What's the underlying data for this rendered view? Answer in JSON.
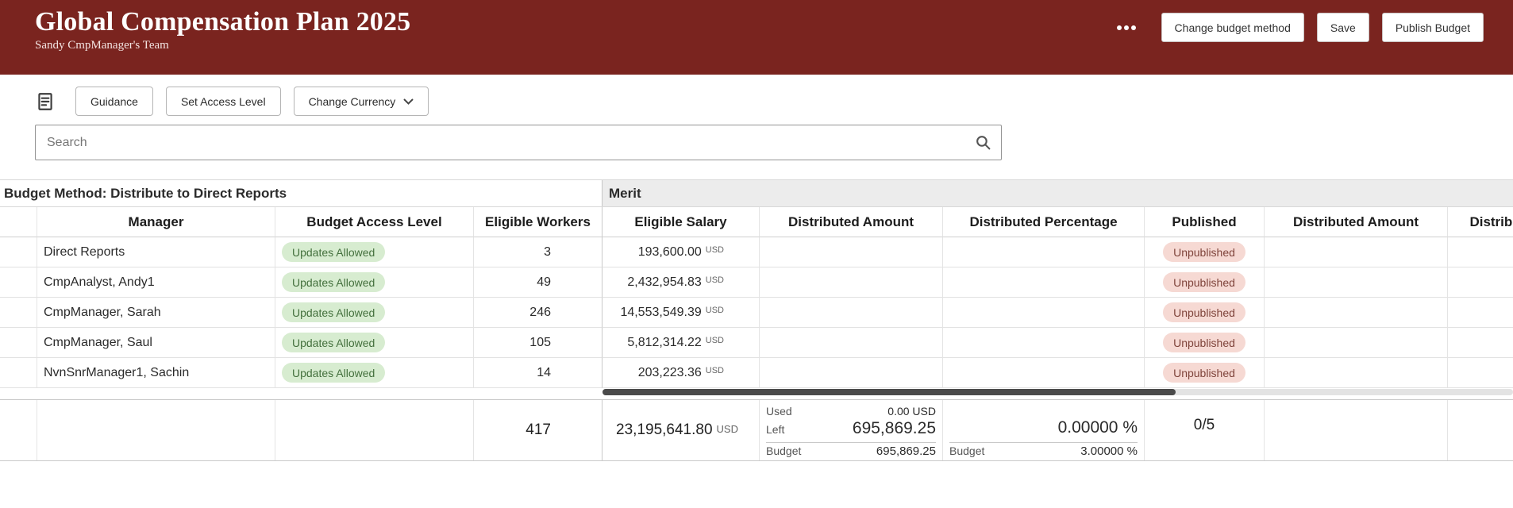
{
  "header": {
    "title": "Global Compensation Plan 2025",
    "subtitle": "Sandy CmpManager's Team",
    "buttons": {
      "change_budget_method": "Change budget method",
      "save": "Save",
      "publish_budget": "Publish Budget"
    }
  },
  "toolbar": {
    "guidance": "Guidance",
    "set_access_level": "Set Access Level",
    "change_currency": "Change Currency"
  },
  "search": {
    "placeholder": "Search"
  },
  "grid": {
    "group_left": "Budget Method: Distribute to Direct Reports",
    "group_right": "Merit",
    "columns": [
      "Manager",
      "Budget Access Level",
      "Eligible Workers",
      "Eligible Salary",
      "Distributed Amount",
      "Distributed Percentage",
      "Published",
      "Distributed Amount",
      "Distributed Percentage"
    ],
    "rows": [
      {
        "manager": "Direct Reports",
        "access": "Updates Allowed",
        "workers": "3",
        "salary": "193,600.00",
        "currency": "USD",
        "published": "Unpublished"
      },
      {
        "manager": "CmpAnalyst, Andy1",
        "access": "Updates Allowed",
        "workers": "49",
        "salary": "2,432,954.83",
        "currency": "USD",
        "published": "Unpublished"
      },
      {
        "manager": "CmpManager, Sarah",
        "access": "Updates Allowed",
        "workers": "246",
        "salary": "14,553,549.39",
        "currency": "USD",
        "published": "Unpublished"
      },
      {
        "manager": "CmpManager, Saul",
        "access": "Updates Allowed",
        "workers": "105",
        "salary": "5,812,314.22",
        "currency": "USD",
        "published": "Unpublished"
      },
      {
        "manager": "NvnSnrManager1, Sachin",
        "access": "Updates Allowed",
        "workers": "14",
        "salary": "203,223.36",
        "currency": "USD",
        "published": "Unpublished"
      }
    ],
    "summary": {
      "workers_total": "417",
      "salary_total": "23,195,641.80",
      "salary_currency": "USD",
      "amount": {
        "used_label": "Used",
        "used_value": "0.00 USD",
        "left_label": "Left",
        "left_value": "695,869.25",
        "budget_label": "Budget",
        "budget_value": "695,869.25"
      },
      "percentage": {
        "value": "0.00000 %",
        "budget_label": "Budget",
        "budget_value": "3.00000 %"
      },
      "published_ratio": "0/5"
    }
  }
}
